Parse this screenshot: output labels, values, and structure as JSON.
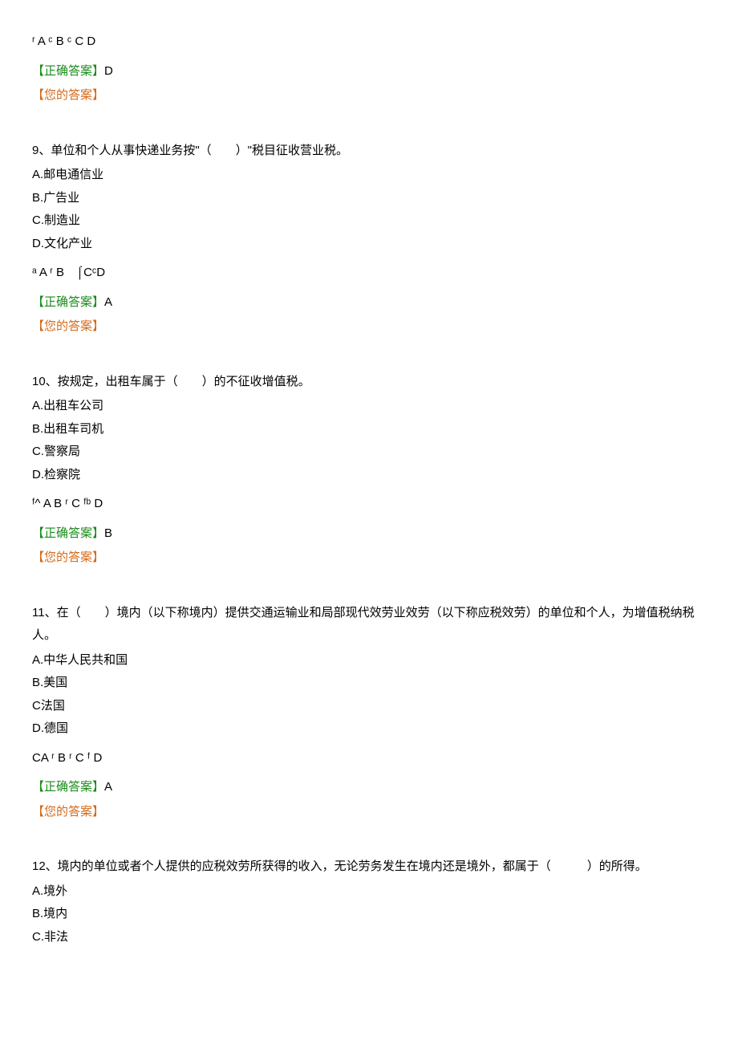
{
  "q8": {
    "choice_markers": "ʳ A ᶜ B ᶜ C D",
    "correct_label": "【正确答案】",
    "correct_value": "D",
    "your_label": "【您的答案】"
  },
  "q9": {
    "stem": "9、单位和个人从事快递业务按\"（　　）\"税目征收营业税。",
    "optA": "A.邮电通信业",
    "optB": "B.广告业",
    "optC": "C.制造业",
    "optD": "D.文化产业",
    "choice_markers": "ᵃ A ʳ B　⌠CᶜD",
    "correct_label": "【正确答案】",
    "correct_value": "A",
    "your_label": "【您的答案】"
  },
  "q10": {
    "stem": "10、按规定，出租车属于（　　）的不征收增值税。",
    "optA": "A.出租车公司",
    "optB": "B.出租车司机",
    "optC": "C.警察局",
    "optD": "D.检察院",
    "choice_markers": "ᶠ^ A B ʳ C ᶠᵇ D",
    "correct_label": "【正确答案】",
    "correct_value": "B",
    "your_label": "【您的答案】"
  },
  "q11": {
    "stem": "11、在（　　）境内（以下称境内）提供交通运输业和局部现代效劳业效劳（以下称应税效劳）的单位和个人，为增值税纳税人。",
    "optA": "A.中华人民共和国",
    "optB": "B.美国",
    "optC": "C法国",
    "optD": "D.德国",
    "choice_markers": "CA ʳ B ʳ C ᶠ D",
    "correct_label": "【正确答案】",
    "correct_value": "A",
    "your_label": "【您的答案】"
  },
  "q12": {
    "stem": "12、境内的单位或者个人提供的应税效劳所获得的收入，无论劳务发生在境内还是境外，都属于（　　　）的所得。",
    "optA": "A.境外",
    "optB": "B.境内",
    "optC": "C.非法"
  }
}
